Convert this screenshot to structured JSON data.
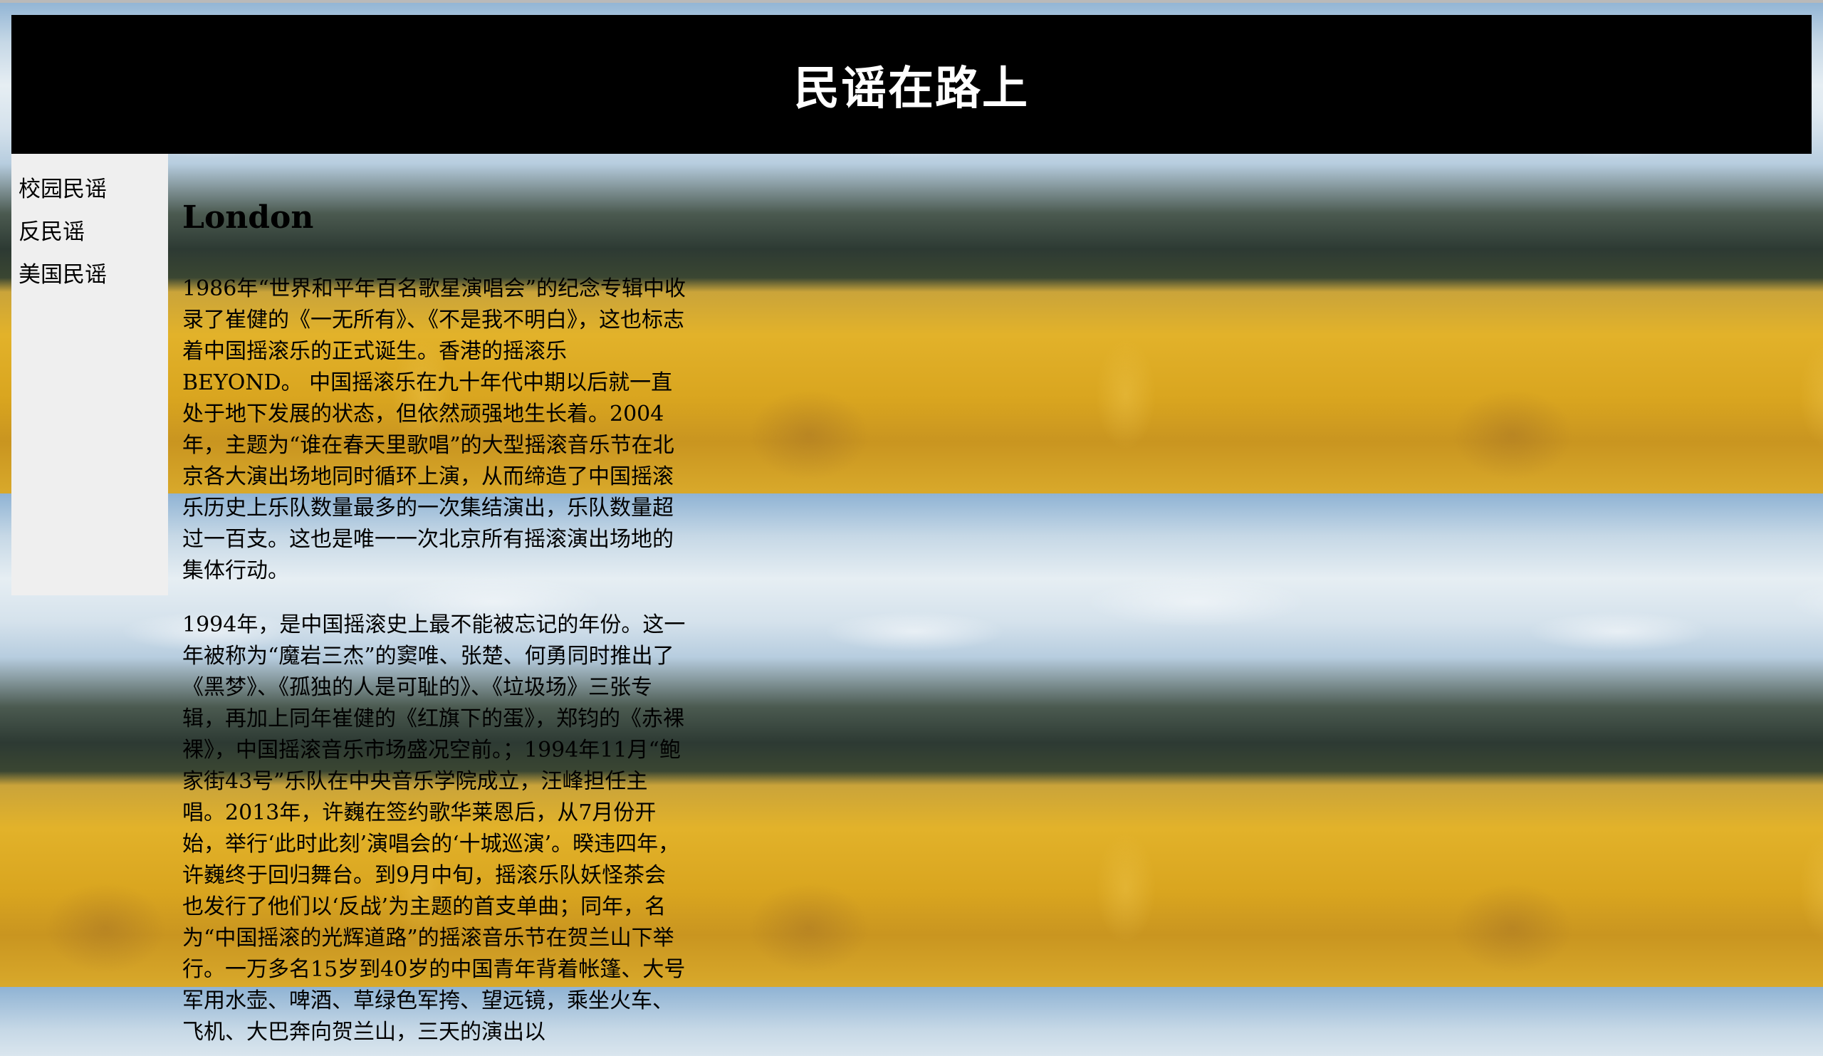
{
  "header": {
    "title": "民谣在路上"
  },
  "sidebar": {
    "items": [
      {
        "label": "校园民谣"
      },
      {
        "label": "反民谣"
      },
      {
        "label": "美国民谣"
      }
    ]
  },
  "main": {
    "heading": "London",
    "paragraphs": [
      "1986年“世界和平年百名歌星演唱会”的纪念专辑中收录了崔健的《一无所有》、《不是我不明白》，这也标志着中国摇滚乐的正式诞生。香港的摇滚乐BEYOND。 中国摇滚乐在九十年代中期以后就一直处于地下发展的状态，但依然顽强地生长着。2004年，主题为“谁在春天里歌唱”的大型摇滚音乐节在北京各大演出场地同时循环上演，从而缔造了中国摇滚乐历史上乐队数量最多的一次集结演出，乐队数量超过一百支。这也是唯一一次北京所有摇滚演出场地的集体行动。",
      "1994年，是中国摇滚史上最不能被忘记的年份。这一年被称为“魔岩三杰”的窦唯、张楚、何勇同时推出了《黑梦》、《孤独的人是可耻的》、《垃圾场》三张专辑，再加上同年崔健的《红旗下的蛋》，郑钧的《赤裸裸》，中国摇滚音乐市场盛况空前。；1994年11月“鲍家街43号”乐队在中央音乐学院成立，汪峰担任主唱。2013年，许巍在签约歌华莱恩后，从7月份开始，举行‘此时此刻’演唱会的‘十城巡演’。暌违四年，许巍终于回归舞台。到9月中旬，摇滚乐队妖怪茶会也发行了他们以‘反战’为主题的首支单曲；同年，名为“中国摇滚的光辉道路”的摇滚音乐节在贺兰山下举行。一万多名15岁到40岁的中国青年背着帐篷、大号军用水壶、啤酒、草绿色军挎、望远镜，乘坐火车、飞机、大巴奔向贺兰山，三天的演出以"
    ]
  }
}
